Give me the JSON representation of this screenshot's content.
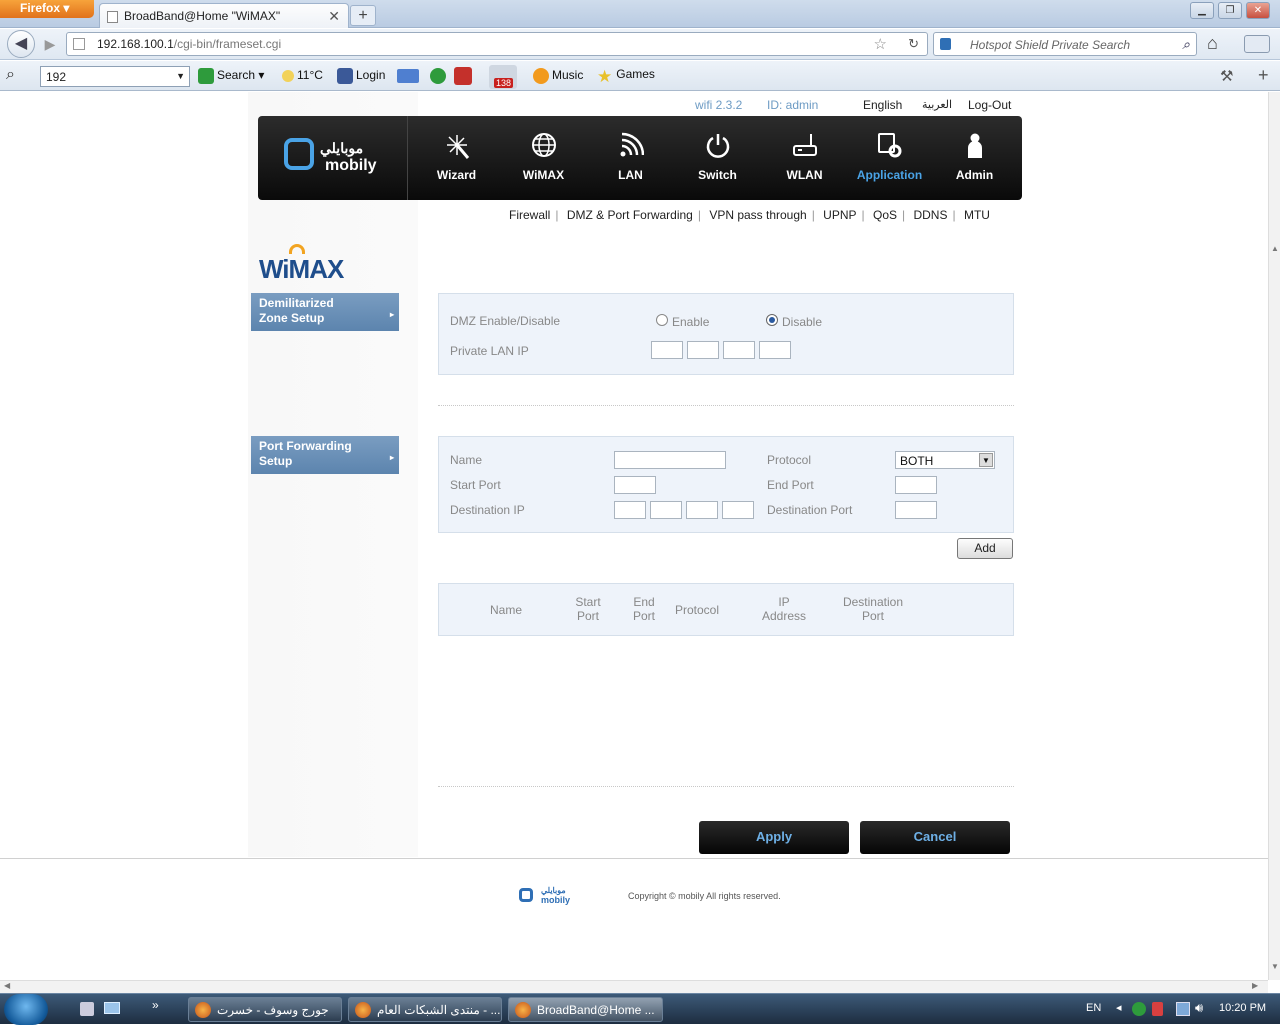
{
  "browser": {
    "menu_button": "Firefox",
    "tab_title": "BroadBand@Home \"WiMAX\"",
    "url_host": "192.168.100.1",
    "url_path": "/cgi-bin/frameset.cgi",
    "search_placeholder": "Hotspot Shield Private Search"
  },
  "toolbar": {
    "search_value": "192",
    "search_label": "Search",
    "weather": "11°C",
    "login_label": "Login",
    "badge_count": "138",
    "music_label": "Music",
    "games_label": "Games"
  },
  "topinfo": {
    "version": "wifi 2.3.2",
    "user_id": "ID: admin",
    "english": "English",
    "arabic": "العربية",
    "logout": "Log-Out"
  },
  "brand": {
    "arabic": "موبايلي",
    "latin": "mobily"
  },
  "main_nav": [
    {
      "label": "Wizard",
      "icon": "wand-icon"
    },
    {
      "label": "WiMAX",
      "icon": "globe-icon"
    },
    {
      "label": "LAN",
      "icon": "signal-icon"
    },
    {
      "label": "Switch",
      "icon": "power-icon"
    },
    {
      "label": "WLAN",
      "icon": "router-icon"
    },
    {
      "label": "Application",
      "icon": "app-gear-icon",
      "active": true
    },
    {
      "label": "Admin",
      "icon": "person-icon"
    }
  ],
  "sub_nav": [
    "Firewall",
    "DMZ & Port Forwarding",
    "VPN pass through",
    "UPNP",
    "QoS",
    "DDNS",
    "MTU"
  ],
  "sidebar": {
    "logo": "WiMAX",
    "dmz_line1": "Demilitarized",
    "dmz_line2": "Zone Setup",
    "pf_line1": "Port Forwarding",
    "pf_line2": "Setup"
  },
  "dmz": {
    "enable_label": "DMZ Enable/Disable",
    "opt_enable": "Enable",
    "opt_disable": "Disable",
    "selected": "Disable",
    "private_ip_label": "Private LAN IP"
  },
  "pf": {
    "name_label": "Name",
    "protocol_label": "Protocol",
    "protocol_value": "BOTH",
    "start_port_label": "Start Port",
    "end_port_label": "End Port",
    "dest_ip_label": "Destination IP",
    "dest_port_label": "Destination Port",
    "add_label": "Add"
  },
  "table_headers": {
    "name": "Name",
    "start_1": "Start",
    "start_2": "Port",
    "end_1": "End",
    "end_2": "Port",
    "protocol": "Protocol",
    "ip_1": "IP",
    "ip_2": "Address",
    "dest_1": "Destination",
    "dest_2": "Port"
  },
  "actions": {
    "apply": "Apply",
    "cancel": "Cancel"
  },
  "footer": {
    "copyright": "Copyright © mobily All rights reserved."
  },
  "taskbar": {
    "task1": "جورج وسوف - خسرت ...",
    "task2": "منتدى الشبكات العام - ...",
    "task3": "BroadBand@Home ...",
    "lang": "EN",
    "time": "10:20 PM"
  },
  "colors": {
    "accent": "#5c84ae",
    "active_nav": "#4aa3e6",
    "button_text": "#6eb0e6"
  }
}
